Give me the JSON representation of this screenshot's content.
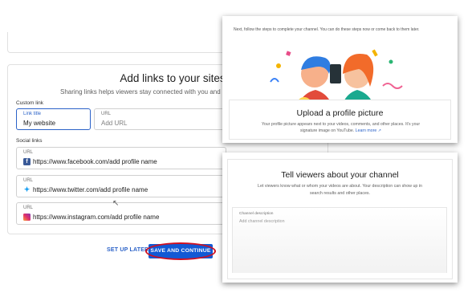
{
  "links_section": {
    "title": "Add links to your sites",
    "subtitle": "Sharing links helps viewers stay connected with you and your la",
    "custom_link_label": "Custom link",
    "link_title_label": "Link title",
    "link_title_value": "My website",
    "url_label": "URL",
    "url_placeholder": "Add URL",
    "social_links_label": "Social links",
    "social": [
      {
        "label": "URL",
        "value": "https://www.facebook.com/add profile name",
        "icon": "facebook-icon"
      },
      {
        "label": "URL",
        "value": "https://www.twitter.com/add profile name",
        "icon": "twitter-icon"
      },
      {
        "label": "URL",
        "value": "https://www.instagram.com/add profile name",
        "icon": "instagram-icon"
      }
    ]
  },
  "actions": {
    "set_up_later": "SET UP LATER",
    "save_continue": "SAVE AND CONTINUE"
  },
  "profile_panel": {
    "intro": "Next, follow the steps to complete your channel. You can do these steps now or come back to them later.",
    "title": "Upload a profile picture",
    "desc": "Your profile picture appears next to your videos, comments, and other places. It's your signature image on YouTube.",
    "learn_more": "Learn more"
  },
  "about_panel": {
    "title": "Tell viewers about your channel",
    "desc": "Let viewers know what or whom your videos are about. Your description can show up in search results and other places.",
    "textarea_label": "Channel description",
    "textarea_placeholder": "Add channel description"
  },
  "colors": {
    "accent": "#1259d4",
    "highlight_ring": "#d01020"
  }
}
